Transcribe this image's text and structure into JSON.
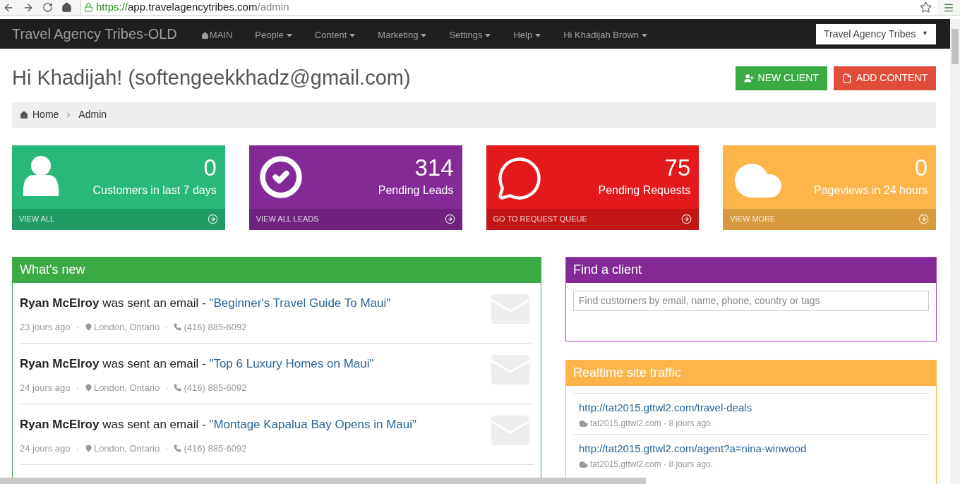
{
  "browser": {
    "url_scheme": "https://",
    "url_host": "app.travelagencytribes.com",
    "url_path": "/admin"
  },
  "navbar": {
    "brand": "Travel Agency Tribes-OLD",
    "items": [
      {
        "label": "MAIN",
        "kind": "home"
      },
      {
        "label": "People",
        "kind": "dropdown"
      },
      {
        "label": "Content",
        "kind": "dropdown"
      },
      {
        "label": "Marketing",
        "kind": "dropdown"
      },
      {
        "label": "Settings",
        "kind": "dropdown"
      },
      {
        "label": "Help",
        "kind": "dropdown"
      },
      {
        "label": "Hi Khadijah Brown",
        "kind": "dropdown"
      }
    ],
    "agency_select": {
      "value": "Travel Agency Tribes",
      "caret": "▼"
    }
  },
  "page_title": "Hi Khadijah! (softengeekkhadz@gmail.com)",
  "actions": [
    {
      "label": "NEW CLIENT",
      "kind": "client",
      "color": "#3aaa45"
    },
    {
      "label": "ADD CONTENT",
      "kind": "content",
      "color": "#e04b3a"
    }
  ],
  "breadcrumb": [
    {
      "label": "Home"
    },
    {
      "label": "Admin"
    }
  ],
  "stats": [
    {
      "value": "0",
      "label": "Customers in last 7 days",
      "link": "VIEW ALL",
      "kind": "person",
      "color": "#27b87a"
    },
    {
      "value": "314",
      "label": "Pending Leads",
      "link": "VIEW ALL LEADS",
      "kind": "check",
      "color": "#832a96"
    },
    {
      "value": "75",
      "label": "Pending Requests",
      "link": "GO TO REQUEST QUEUE",
      "kind": "chat",
      "color": "#e4191b"
    },
    {
      "value": "0",
      "label": "Pageviews in 24 hours",
      "link": "VIEW MORE",
      "kind": "cloud",
      "color": "#fdb54a"
    }
  ],
  "whats_new": {
    "title": "What's new",
    "separator": "·",
    "items": [
      {
        "name": "Ryan McElroy",
        "action": "was sent an email -",
        "title": "\"Beginner's Travel Guide To Maui\"",
        "time": "23 jours ago",
        "location": "London, Ontario",
        "phone": "(416) 885-6092"
      },
      {
        "name": "Ryan McElroy",
        "action": "was sent an email -",
        "title": "\"Top 6 Luxury Homes on Maui\"",
        "time": "24 jours ago",
        "location": "London, Ontario",
        "phone": "(416) 885-6092"
      },
      {
        "name": "Ryan McElroy",
        "action": "was sent an email -",
        "title": "\"Montage Kapalua Bay Opens in Maui\"",
        "time": "24 jours ago",
        "location": "London, Ontario",
        "phone": "(416) 885-6092"
      }
    ]
  },
  "find_client": {
    "title": "Find a client",
    "placeholder": "Find customers by email, name, phone, country or tags"
  },
  "traffic": {
    "title": "Realtime site traffic",
    "items": [
      {
        "url": "http://tat2015.gttwl2.com/travel-deals",
        "meta": "tat2015.gttwl2.com · 8 jours ago."
      },
      {
        "url": "http://tat2015.gttwl2.com/agent?a=nina-winwood",
        "meta": "tat2015.gttwl2.com · 8 jours ago."
      }
    ]
  }
}
